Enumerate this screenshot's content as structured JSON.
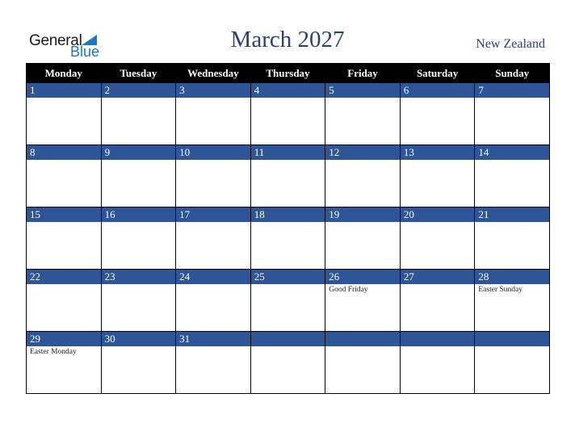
{
  "logo": {
    "general": "General",
    "blue": "Blue"
  },
  "title": "March 2027",
  "country": "New Zealand",
  "colors": {
    "header_bg": "#000000",
    "band": "#2e5597",
    "title": "#2a4272",
    "logo_blue": "#1f77c4"
  },
  "weekdays": [
    "Monday",
    "Tuesday",
    "Wednesday",
    "Thursday",
    "Friday",
    "Saturday",
    "Sunday"
  ],
  "weeks": [
    [
      {
        "day": "1",
        "holiday": ""
      },
      {
        "day": "2",
        "holiday": ""
      },
      {
        "day": "3",
        "holiday": ""
      },
      {
        "day": "4",
        "holiday": ""
      },
      {
        "day": "5",
        "holiday": ""
      },
      {
        "day": "6",
        "holiday": ""
      },
      {
        "day": "7",
        "holiday": ""
      }
    ],
    [
      {
        "day": "8",
        "holiday": ""
      },
      {
        "day": "9",
        "holiday": ""
      },
      {
        "day": "10",
        "holiday": ""
      },
      {
        "day": "11",
        "holiday": ""
      },
      {
        "day": "12",
        "holiday": ""
      },
      {
        "day": "13",
        "holiday": ""
      },
      {
        "day": "14",
        "holiday": ""
      }
    ],
    [
      {
        "day": "15",
        "holiday": ""
      },
      {
        "day": "16",
        "holiday": ""
      },
      {
        "day": "17",
        "holiday": ""
      },
      {
        "day": "18",
        "holiday": ""
      },
      {
        "day": "19",
        "holiday": ""
      },
      {
        "day": "20",
        "holiday": ""
      },
      {
        "day": "21",
        "holiday": ""
      }
    ],
    [
      {
        "day": "22",
        "holiday": ""
      },
      {
        "day": "23",
        "holiday": ""
      },
      {
        "day": "24",
        "holiday": ""
      },
      {
        "day": "25",
        "holiday": ""
      },
      {
        "day": "26",
        "holiday": "Good Friday"
      },
      {
        "day": "27",
        "holiday": ""
      },
      {
        "day": "28",
        "holiday": "Easter Sunday"
      }
    ],
    [
      {
        "day": "29",
        "holiday": "Easter Monday"
      },
      {
        "day": "30",
        "holiday": ""
      },
      {
        "day": "31",
        "holiday": ""
      },
      {
        "day": "",
        "holiday": ""
      },
      {
        "day": "",
        "holiday": ""
      },
      {
        "day": "",
        "holiday": ""
      },
      {
        "day": "",
        "holiday": ""
      }
    ]
  ]
}
